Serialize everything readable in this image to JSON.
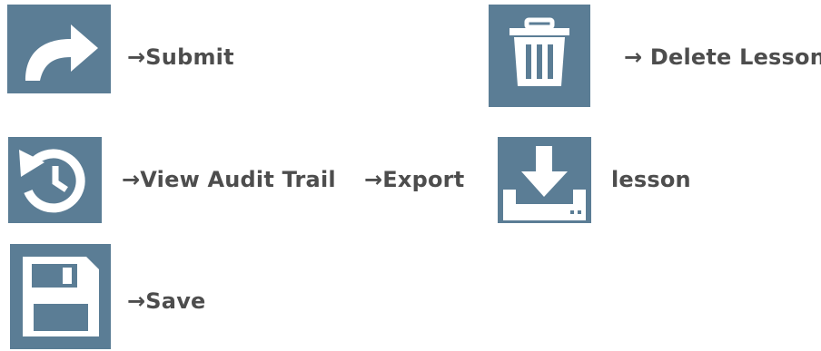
{
  "legend": {
    "submit": {
      "icon": "redo-arrow-icon",
      "label": "→Submit"
    },
    "delete_lesson": {
      "icon": "trash-icon",
      "label": "→ Delete Lesson"
    },
    "view_audit_trail": {
      "icon": "history-icon",
      "label": "→View Audit Trail"
    },
    "export": {
      "label": "→Export"
    },
    "export_lesson": {
      "icon": "download-icon",
      "label": "lesson"
    },
    "save": {
      "icon": "floppy-disk-icon",
      "label": "→Save"
    }
  },
  "colors": {
    "icon_tile": "#5b7d95",
    "icon_glyph": "#ffffff",
    "text": "#4d4d4d"
  }
}
